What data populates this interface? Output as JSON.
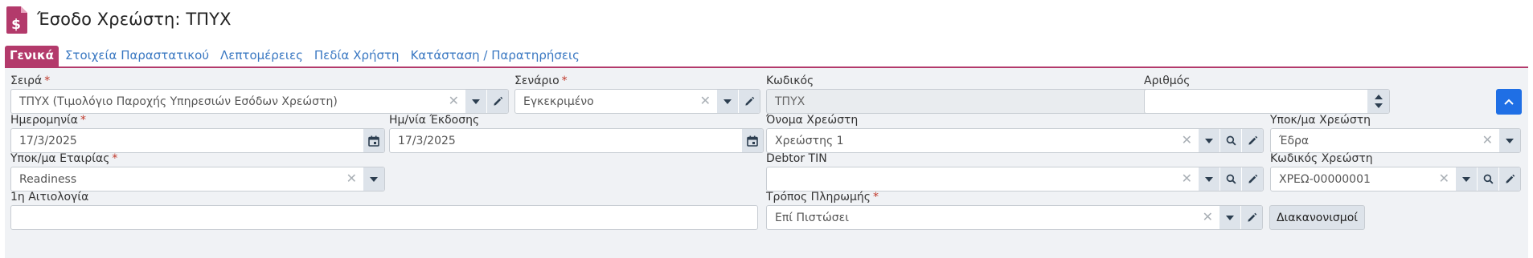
{
  "header": {
    "title": "Έσοδο Χρεώστη: ΤΠΥΧ",
    "icon": "document-dollar-icon"
  },
  "tabs": [
    {
      "label": "Γενικά",
      "active": true
    },
    {
      "label": "Στοιχεία Παραστατικού",
      "active": false
    },
    {
      "label": "Λεπτομέρειες",
      "active": false
    },
    {
      "label": "Πεδία Χρήστη",
      "active": false
    },
    {
      "label": "Κατάσταση / Παρατηρήσεις",
      "active": false
    }
  ],
  "colors": {
    "accent": "#b33a6b",
    "link": "#3a78c2",
    "primary_button": "#1f6fe5",
    "required": "#c0392b",
    "panel_bg": "#f0f2f5"
  },
  "form": {
    "series": {
      "label": "Σειρά",
      "required_mark": "*",
      "value": "ΤΠΥΧ (Τιμολόγιο Παροχής Υπηρεσιών Εσόδων Χρεώστη)"
    },
    "scenario": {
      "label": "Σενάριο",
      "required_mark": "*",
      "value": "Εγκεκριμένο"
    },
    "code": {
      "label": "Κωδικός",
      "value": "ΤΠΥΧ"
    },
    "number": {
      "label": "Αριθμός",
      "value": ""
    },
    "date": {
      "label": "Ημερομηνία",
      "required_mark": "*",
      "value": "17/3/2025"
    },
    "issue_date": {
      "label": "Ημ/νία Έκδοσης",
      "value": "17/3/2025"
    },
    "debtor_name": {
      "label": "Όνομα Χρεώστη",
      "value": "Χρεώστης 1"
    },
    "debtor_branch": {
      "label": "Υποκ/μα Χρεώστη",
      "value": "Έδρα"
    },
    "company_branch": {
      "label": "Υποκ/μα Εταιρίας",
      "required_mark": "*",
      "value": "Readiness"
    },
    "debtor_tin": {
      "label": "Debtor TIN",
      "value": ""
    },
    "debtor_code": {
      "label": "Κωδικός Χρεώστη",
      "value": "ΧΡΕΩ-00000001"
    },
    "reason": {
      "label": "1η Αιτιολογία",
      "value": ""
    },
    "payment_method": {
      "label": "Τρόπος Πληρωμής",
      "required_mark": "*",
      "value": "Επί Πιστώσει"
    },
    "settlements_button": "Διακανονισμοί"
  }
}
